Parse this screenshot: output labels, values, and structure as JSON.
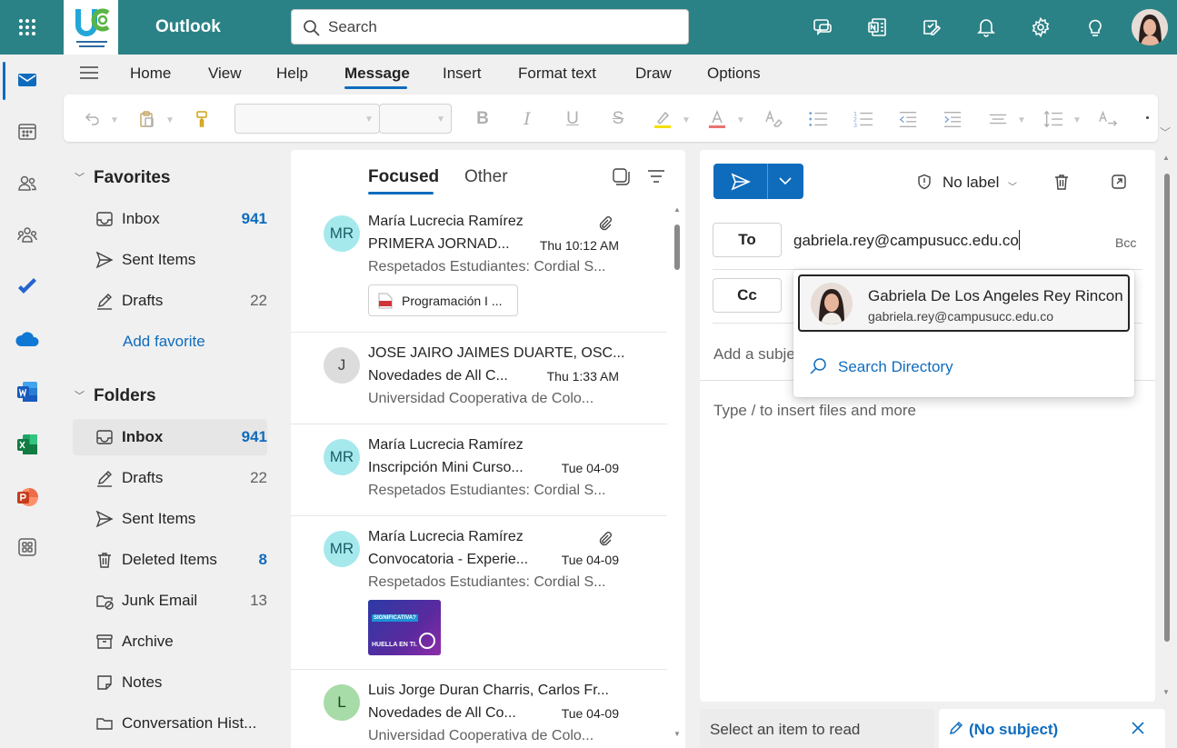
{
  "app": {
    "name": "Outlook"
  },
  "search": {
    "placeholder": "Search"
  },
  "tabs": [
    "Home",
    "View",
    "Help",
    "Message",
    "Insert",
    "Format text",
    "Draw",
    "Options"
  ],
  "folders": {
    "favorites_label": "Favorites",
    "favorites": [
      {
        "label": "Inbox",
        "count": "941",
        "count_style": "bold"
      },
      {
        "label": "Sent Items",
        "count": ""
      },
      {
        "label": "Drafts",
        "count": "22"
      }
    ],
    "add_favorite": "Add favorite",
    "folders_label": "Folders",
    "items": [
      {
        "label": "Inbox",
        "count": "941",
        "count_style": "bold"
      },
      {
        "label": "Drafts",
        "count": "22"
      },
      {
        "label": "Sent Items",
        "count": ""
      },
      {
        "label": "Deleted Items",
        "count": "8",
        "count_style": "bold"
      },
      {
        "label": "Junk Email",
        "count": "13"
      },
      {
        "label": "Archive",
        "count": ""
      },
      {
        "label": "Notes",
        "count": ""
      },
      {
        "label": "Conversation Hist...",
        "count": ""
      }
    ]
  },
  "list": {
    "focused": "Focused",
    "other": "Other",
    "messages": [
      {
        "initials": "MR",
        "sender": "María Lucrecia Ramírez",
        "subject": "PRIMERA JORNAD...",
        "date": "Thu 10:12 AM",
        "preview": "Respetados Estudiantes: Cordial S...",
        "attachment": "Programación I ...",
        "avatar_color": "#a6e9ed",
        "avatar_text": "#1a5f66"
      },
      {
        "initials": "J",
        "sender": "JOSE JAIRO JAIMES DUARTE, OSC...",
        "subject": "Novedades de All C...",
        "date": "Thu 1:33 AM",
        "preview": "Universidad Cooperativa de Colo...",
        "avatar_color": "#dcdcdc",
        "avatar_text": "#424242"
      },
      {
        "initials": "MR",
        "sender": "María Lucrecia Ramírez",
        "subject": "Inscripción Mini Curso...",
        "date": "Tue 04-09",
        "preview": "Respetados Estudiantes: Cordial S...",
        "avatar_color": "#a6e9ed",
        "avatar_text": "#1a5f66"
      },
      {
        "initials": "MR",
        "sender": "María Lucrecia Ramírez",
        "subject": "Convocatoria - Experie...",
        "date": "Tue 04-09",
        "preview": "Respetados Estudiantes: Cordial S...",
        "thumbnail": {
          "line1": "SIGNIFICATIVA?",
          "line2": "HUELLA EN TI."
        },
        "avatar_color": "#a6e9ed",
        "avatar_text": "#1a5f66"
      },
      {
        "initials": "L",
        "sender": "Luis Jorge Duran Charris, Carlos Fr...",
        "subject": "Novedades de All Co...",
        "date": "Tue 04-09",
        "preview": "Universidad Cooperativa de Colo...",
        "avatar_color": "#a7dba7",
        "avatar_text": "#0e4d0e"
      }
    ]
  },
  "compose": {
    "label_button": "No label",
    "to_label": "To",
    "cc_label": "Cc",
    "bcc_label": "Bcc",
    "to_value": "gabriela.rey@campusucc.edu.co",
    "subject_placeholder": "Add a subje",
    "body_placeholder": "Type / to insert files and more"
  },
  "suggestion": {
    "name": "Gabriela De Los Angeles Rey Rincon",
    "email": "gabriela.rey@campusucc.edu.co",
    "search_directory": "Search Directory"
  },
  "bottom": {
    "reading": "Select an item to read",
    "draft": "(No subject)"
  },
  "colors": {
    "brand": "#2b8286",
    "accent": "#0f6cbd"
  }
}
